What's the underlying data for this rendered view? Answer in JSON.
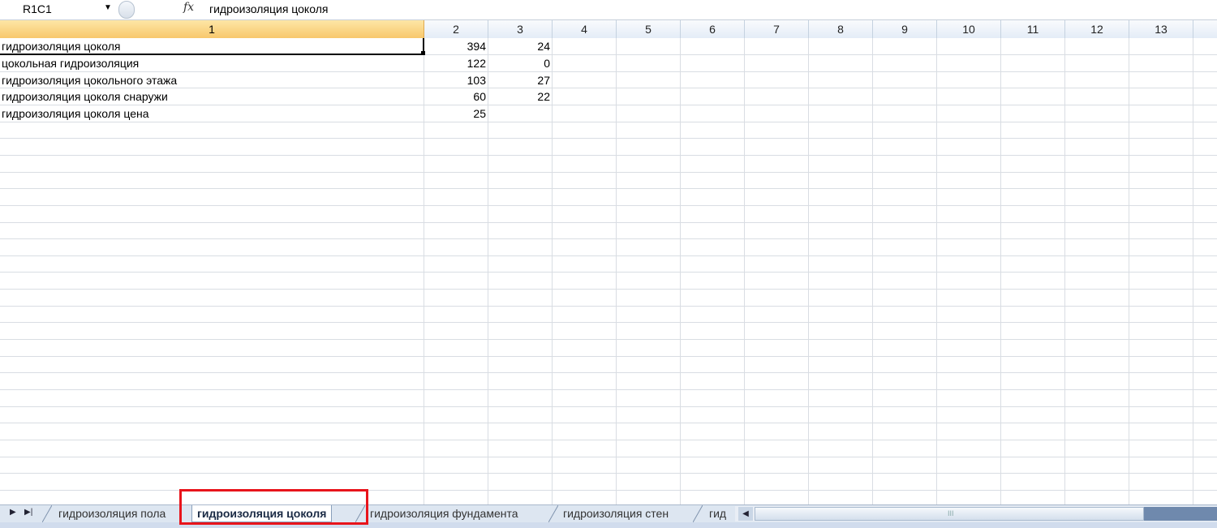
{
  "formula_bar": {
    "name_box": "R1C1",
    "fx_label": "fx",
    "formula": "гидроизоляция цоколя"
  },
  "columns": [
    "1",
    "2",
    "3",
    "4",
    "5",
    "6",
    "7",
    "8",
    "9",
    "10",
    "11",
    "12",
    "13"
  ],
  "rows": [
    {
      "c1": "гидроизоляция цоколя",
      "c2": "394",
      "c3": "24"
    },
    {
      "c1": "цокольная гидроизоляция",
      "c2": "122",
      "c3": "0"
    },
    {
      "c1": "гидроизоляция цокольного этажа",
      "c2": "103",
      "c3": "27"
    },
    {
      "c1": "гидроизоляция цоколя снаружи",
      "c2": "60",
      "c3": "22"
    },
    {
      "c1": "гидроизоляция цоколя цена",
      "c2": "25",
      "c3": ""
    }
  ],
  "sheet_tabs": [
    {
      "label": "гидроизоляция пола",
      "active": false
    },
    {
      "label": "гидроизоляция цоколя",
      "active": true
    },
    {
      "label": "гидроизоляция фундамента",
      "active": false
    },
    {
      "label": "гидроизоляция стен",
      "active": false
    },
    {
      "label": "гид",
      "active": false
    }
  ],
  "scroll_grip": "III"
}
